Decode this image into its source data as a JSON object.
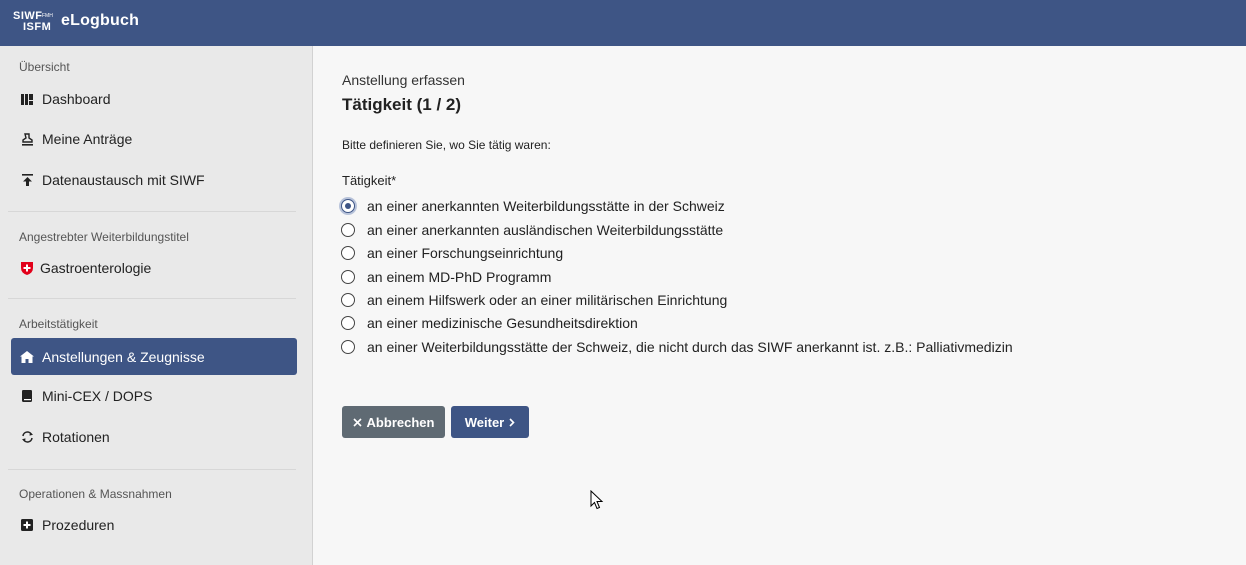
{
  "header": {
    "logo_line1": "SIWF",
    "logo_line1_small": "FMH",
    "logo_line2": "ISFM",
    "app_title": "eLogbuch"
  },
  "sidebar": {
    "sections": [
      {
        "title": "Übersicht",
        "items": [
          {
            "label": "Dashboard",
            "icon": "dashboard-icon"
          },
          {
            "label": "Meine Anträge",
            "icon": "stamp-icon"
          },
          {
            "label": "Datenaustausch mit SIWF",
            "icon": "upload-icon"
          }
        ]
      },
      {
        "title": "Angestrebter Weiterbildungstitel",
        "items": [
          {
            "label": "Gastroenterologie",
            "icon": "swiss-shield-icon"
          }
        ]
      },
      {
        "title": "Arbeitstätigkeit",
        "items": [
          {
            "label": "Anstellungen & Zeugnisse",
            "icon": "home-icon",
            "active": true
          },
          {
            "label": "Mini-CEX / DOPS",
            "icon": "book-icon"
          },
          {
            "label": "Rotationen",
            "icon": "rotate-icon"
          }
        ]
      },
      {
        "title": "Operationen & Massnahmen",
        "items": [
          {
            "label": "Prozeduren",
            "icon": "plus-square-icon"
          }
        ]
      }
    ]
  },
  "form": {
    "subtitle": "Anstellung erfassen",
    "title": "Tätigkeit (1 / 2)",
    "instruction": "Bitte definieren Sie, wo Sie tätig waren:",
    "field_label": "Tätigkeit*",
    "options": [
      {
        "label": "an einer anerkannten Weiterbildungsstätte in der Schweiz",
        "checked": true
      },
      {
        "label": "an einer anerkannten ausländischen Weiterbildungsstätte",
        "checked": false
      },
      {
        "label": "an einer Forschungseinrichtung",
        "checked": false
      },
      {
        "label": "an einem MD-PhD Programm",
        "checked": false
      },
      {
        "label": "an einem Hilfswerk oder an einer militärischen Einrichtung",
        "checked": false
      },
      {
        "label": "an einer medizinische Gesundheitsdirektion",
        "checked": false
      },
      {
        "label": "an einer Weiterbildungsstätte der Schweiz, die nicht durch das SIWF anerkannt ist. z.B.: Palliativmedizin",
        "checked": false
      }
    ],
    "cancel_label": "Abbrechen",
    "next_label": "Weiter"
  },
  "colors": {
    "brand": "#3e5585",
    "sidebar_bg": "#e9e9e9",
    "cancel_bg": "#5f6a73",
    "swiss_red": "#e2001a"
  }
}
